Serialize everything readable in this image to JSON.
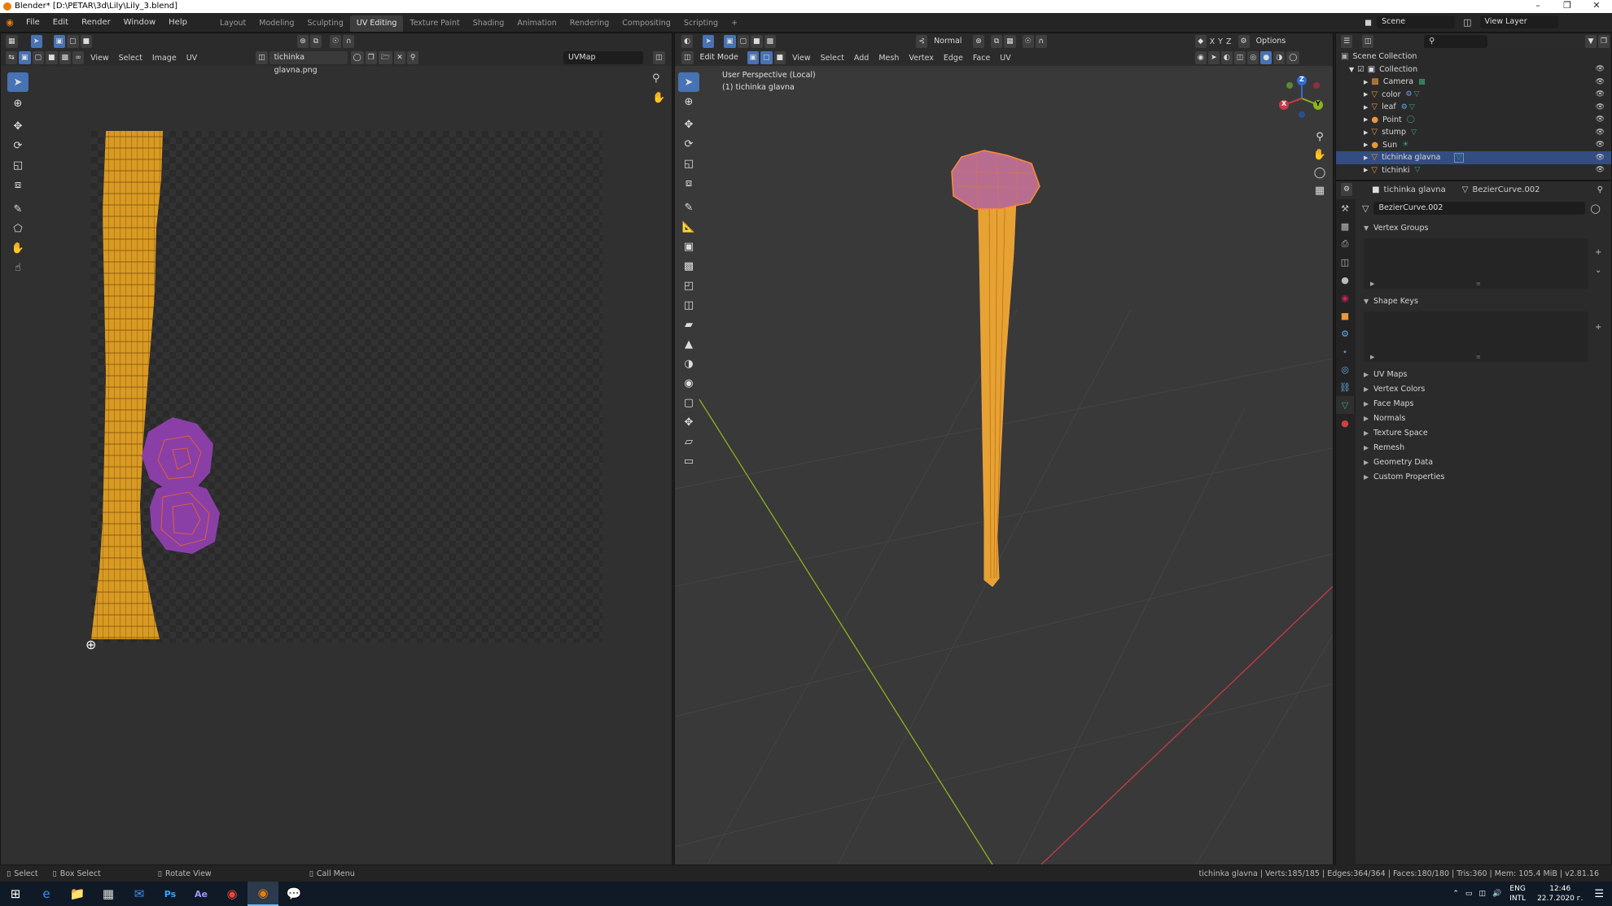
{
  "window": {
    "title": "Blender* [D:\\PETAR\\3d\\Lily\\Lily_3.blend]"
  },
  "menu": [
    "File",
    "Edit",
    "Render",
    "Window",
    "Help"
  ],
  "workspaces": [
    "Layout",
    "Modeling",
    "Sculpting",
    "UV Editing",
    "Texture Paint",
    "Shading",
    "Animation",
    "Rendering",
    "Compositing",
    "Scripting"
  ],
  "active_workspace": "UV Editing",
  "scene": {
    "name": "Scene",
    "view_layer": "View Layer"
  },
  "uv_editor": {
    "menus": [
      "View",
      "Select",
      "Image",
      "UV"
    ],
    "image_name": "tichinka glavna.png",
    "uv_map": "UVMap"
  },
  "viewport": {
    "mode": "Edit Mode",
    "menus": [
      "View",
      "Select",
      "Add",
      "Mesh",
      "Vertex",
      "Edge",
      "Face",
      "UV"
    ],
    "orientation": "Normal",
    "options": "Options",
    "overlay_line1": "User Perspective (Local)",
    "overlay_line2": "(1) tichinka glavna",
    "axes": [
      "X",
      "Y",
      "Z"
    ],
    "gizmo": {
      "x": "X",
      "y": "Y",
      "z": "Z"
    }
  },
  "outliner": {
    "root": "Scene Collection",
    "collection": "Collection",
    "items": [
      {
        "name": "Camera",
        "selected": false
      },
      {
        "name": "color",
        "selected": false
      },
      {
        "name": "leaf",
        "selected": false
      },
      {
        "name": "Point",
        "selected": false
      },
      {
        "name": "stump",
        "selected": false
      },
      {
        "name": "Sun",
        "selected": false
      },
      {
        "name": "tichinka glavna",
        "selected": true
      },
      {
        "name": "tichinki",
        "selected": false
      }
    ]
  },
  "properties": {
    "object": "tichinka glavna",
    "data": "BezierCurve.002",
    "datablock": "BezierCurve.002",
    "open_panels": [
      "Vertex Groups",
      "Shape Keys"
    ],
    "closed_panels": [
      "UV Maps",
      "Vertex Colors",
      "Face Maps",
      "Normals",
      "Texture Space",
      "Remesh",
      "Geometry Data",
      "Custom Properties"
    ]
  },
  "status": {
    "select": "Select",
    "box_select": "Box Select",
    "rotate": "Rotate View",
    "call_menu": "Call Menu",
    "stats": "tichinka glavna | Verts:185/185 | Edges:364/364 | Faces:180/180 | Tris:360 | Mem: 105.4 MiB | v2.81.16"
  },
  "taskbar": {
    "lang1": "ENG",
    "lang2": "INTL",
    "time": "12:46",
    "date": "22.7.2020 г."
  },
  "colors": {
    "accent": "#4772b3",
    "orange": "#e8973c",
    "x_axis": "#c73a48",
    "y_axis": "#8ab31e",
    "z_axis": "#2f6cd6"
  }
}
